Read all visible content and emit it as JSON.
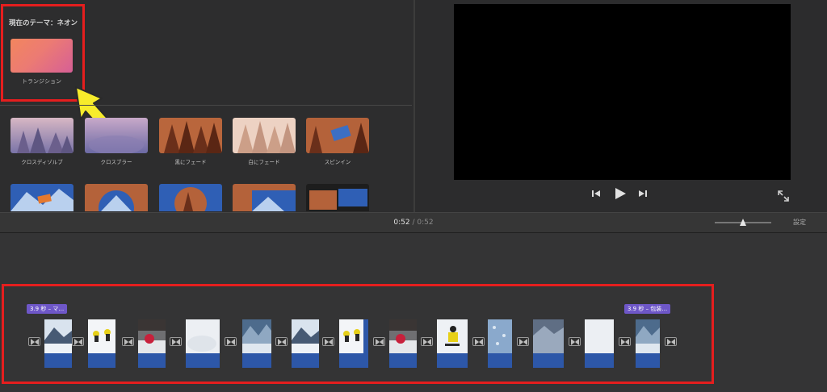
{
  "theme_browser": {
    "current_theme": "現在のテーマ：ネオン",
    "theme_item_label": "トランジション",
    "transitions_row1": [
      "クロスディゾルブ",
      "クロスブラー",
      "黒にフェード",
      "白にフェード",
      "スピンイン"
    ]
  },
  "viewer": {
    "prev_icon": "skip-back-icon",
    "play_icon": "play-icon",
    "next_icon": "skip-forward-icon",
    "fullscreen_icon": "fullscreen-icon"
  },
  "toolbar": {
    "current_time": "0:52",
    "separator": "/",
    "total_time": "0:52",
    "settings_label": "設定"
  },
  "timeline": {
    "title_tag_1": "3.9 秒 – マ…",
    "title_tag_2": "3.9 秒 – 包装…",
    "clip_count": 14,
    "transition_icon": "transition-bowtie-icon"
  },
  "annotations": {
    "highlight_color": "#e51e1e",
    "arrow_color": "#f7ec2b"
  }
}
